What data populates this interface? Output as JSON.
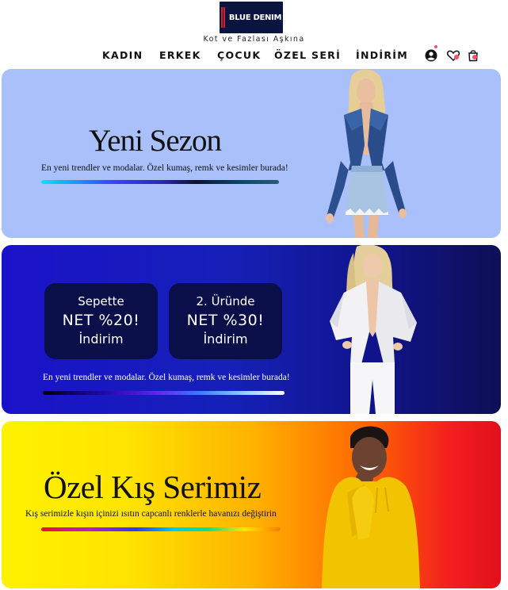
{
  "header": {
    "logo_text": "BLUE DENIM",
    "tagline": "Kot ve Fazlası Aşkına"
  },
  "nav": {
    "items": [
      {
        "label": "KADIN"
      },
      {
        "label": "ERKEK"
      },
      {
        "label": "ÇOCUK"
      },
      {
        "label": "ÖZEL SERİ"
      },
      {
        "label": "İNDİRİM"
      }
    ],
    "icons": [
      "user-icon",
      "heart-icon",
      "shopping-bag-icon"
    ]
  },
  "banners": {
    "new_season": {
      "title": "Yeni Sezon",
      "subtitle": "En yeni trendler ve modalar. Özel kumaş, remk ve kesimler burada!"
    },
    "discount": {
      "promo1": {
        "line1": "Sepette",
        "line2": "NET %20!",
        "line3": "İndirim"
      },
      "promo2": {
        "line1": "2. Üründe",
        "line2": "NET %30!",
        "line3": "İndirim"
      },
      "subtitle": "En yeni trendler ve modalar. Özel kumaş, remk ve kesimler burada!"
    },
    "winter": {
      "title": "Özel Kış Serimiz",
      "subtitle": "Kış serimizle kışın içinizi ısıtın capcanlı renklerle havanızı değiştirin"
    }
  },
  "colors": {
    "banner1_bg": "#a9c0fb",
    "banner2_bg": "#1a12c9",
    "promo_box": "#0a0f4a",
    "logo_bg": "#0a1440",
    "badge": "#ff4d6d"
  }
}
